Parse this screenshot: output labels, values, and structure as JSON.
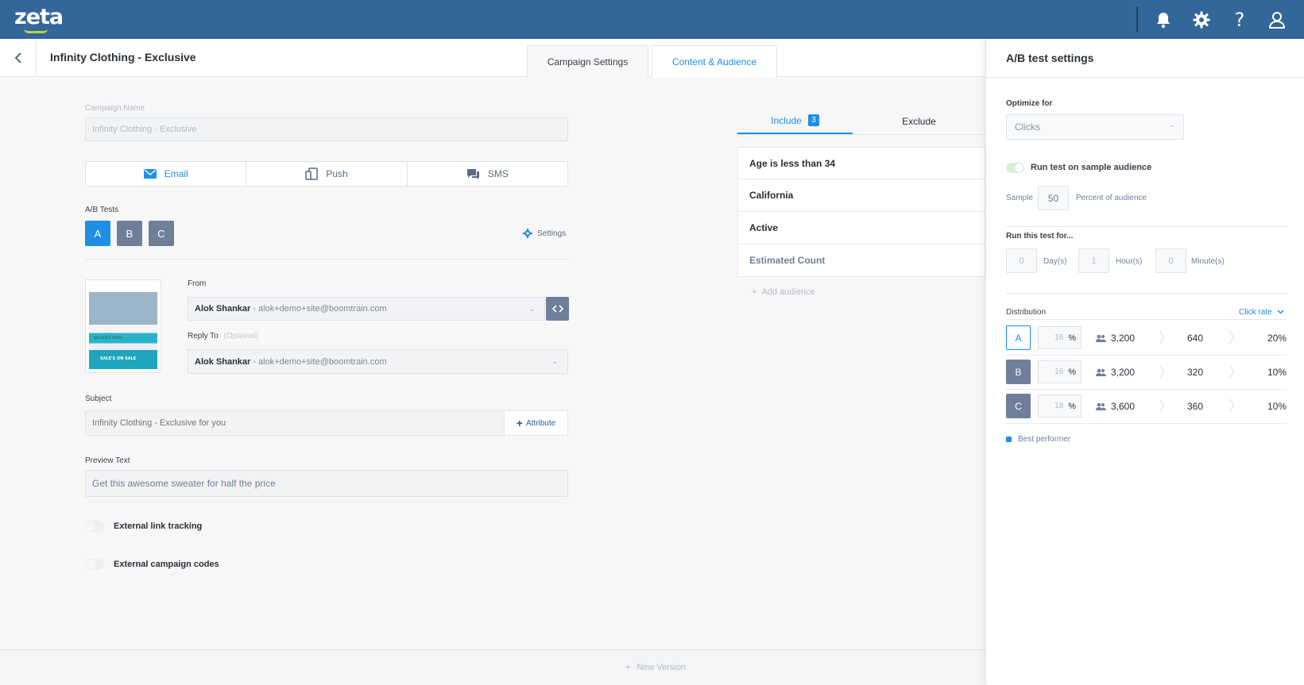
{
  "topbar": {
    "logo": "zeta",
    "icons": [
      "bell-icon",
      "gear-icon",
      "help-icon",
      "user-icon"
    ],
    "color": "#336699"
  },
  "header": {
    "title": "Infinity Clothing - Exclusive",
    "tabs": [
      {
        "label": "Campaign Settings",
        "active": false
      },
      {
        "label": "Content & Audience",
        "active": true
      }
    ]
  },
  "form": {
    "campaign_name_label": "Campaign Name",
    "campaign_name_value": "Infinity Clothing - Exclusive",
    "channels": [
      {
        "label": "Email",
        "icon": "email-icon",
        "active": true
      },
      {
        "label": "Push",
        "icon": "mobile-icon",
        "active": false
      },
      {
        "label": "SMS",
        "icon": "chat-icon",
        "active": false
      }
    ],
    "ab_label": "A/B Tests",
    "ab_variants": [
      "A",
      "B",
      "C"
    ],
    "settings_label": "Settings",
    "from_label": "From",
    "from_name": "Alok Shankar",
    "from_email": "- alok+demo+site@boomtrain.com",
    "reply_label": "Reply To",
    "reply_optional": "(Optional)",
    "reply_name": "Alok Shankar",
    "reply_email": "- alok+demo+site@boomtrain.com",
    "subject_label": "Subject",
    "subject_placeholder": "Infinity Clothing - Exclusive for you",
    "attribute_label": "Attribute",
    "preview_label": "Preview Text",
    "preview_value": "Get this awesome sweater for half the price",
    "toggle1": "External link tracking",
    "toggle2": "External campaign codes",
    "thumb": {
      "offer": "BIG OFFER TODAY",
      "sale": "SALE'S ON SALE"
    }
  },
  "audience": {
    "include_label": "Include",
    "include_count": "3",
    "exclude_label": "Exclude",
    "criteria": [
      "Age is less than 34",
      "California",
      "Active"
    ],
    "estimated": "Estimated Count",
    "add": "Add audience"
  },
  "footer": {
    "new_version": "New Version"
  },
  "ab_panel": {
    "title": "A/B test settings",
    "optimize_label": "Optimize for",
    "optimize_value": "Clicks",
    "run_sample_label": "Run test on sample audience",
    "sample_label": "Sample",
    "sample_value": "50",
    "percent_label": "Percent of audience",
    "run_for_label": "Run this test for...",
    "days_value": "0",
    "days_label": "Day(s)",
    "hours_value": "1",
    "hours_label": "Hour(s)",
    "minutes_value": "0",
    "minutes_label": "Minute(s)",
    "distribution_label": "Distribution",
    "metric_label": "Click rate",
    "rows": [
      {
        "variant": "A",
        "pct": "16",
        "audience": "3,200",
        "clicks": "640",
        "rate": "20%"
      },
      {
        "variant": "B",
        "pct": "16",
        "audience": "3,200",
        "clicks": "320",
        "rate": "10%"
      },
      {
        "variant": "C",
        "pct": "18",
        "audience": "3,600",
        "clicks": "360",
        "rate": "10%"
      }
    ],
    "pct_sign": "%",
    "legend": "Best performer",
    "accent": "#1f8fe5"
  }
}
